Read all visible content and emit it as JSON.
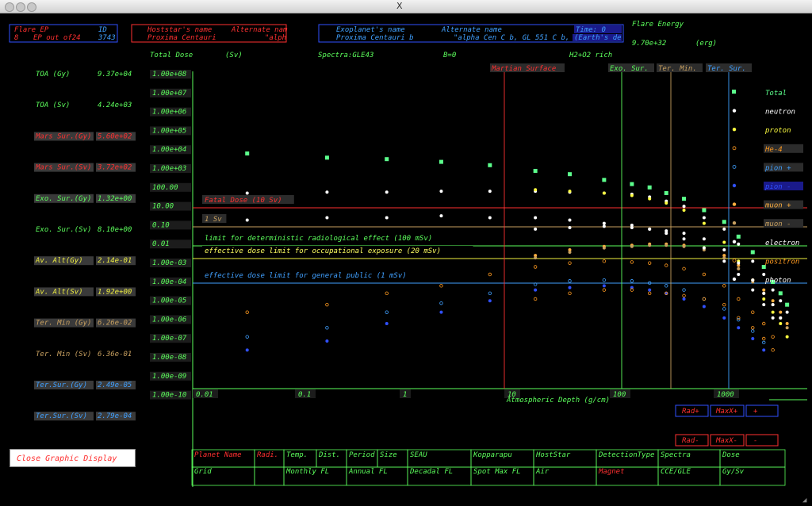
{
  "window": {
    "title_glyph": "X"
  },
  "header": {
    "flare_ep_label": "Flare EP",
    "id_label": "ID",
    "ep_index": "8",
    "ep_count_label": "EP out of24",
    "id_value": "3743",
    "hoststar_label": "Hoststar's name",
    "hoststar_alt_label": "Alternate nam",
    "hoststar_name": "Proxima Centauri",
    "hoststar_alt": "\"alph",
    "exoplanet_label": "Exoplanet's name",
    "exoplanet_alt_label": "Alternate name",
    "exoplanet_name": "Proxima Centauri b",
    "exoplanet_alt": "\"alpha Cen C b, GL 551 C b,",
    "time_label": "Time: 0",
    "earth_label": "(Earth's de",
    "flare_energy_label": "Flare Energy",
    "flare_energy_value": "9.70e+32",
    "flare_energy_unit": "(erg)"
  },
  "subheader": {
    "total_dose": "Total Dose",
    "unit": "(Sv)",
    "spectra": "Spectra:GLE43",
    "b_field": "B=0",
    "atmosphere": "H2+O2 rich"
  },
  "readouts": [
    {
      "label": "TOA (Gy)",
      "value": "9.37e+04",
      "color": "#5cff5c",
      "bg": "transparent"
    },
    {
      "label": "TOA (Sv)",
      "value": "4.24e+03",
      "color": "#5cff5c",
      "bg": "transparent"
    },
    {
      "label": "Mars Sur.(Gy)",
      "value": "5.60e+02",
      "color": "#ff3030",
      "bg": "#3a3a3a"
    },
    {
      "label": "Mars Sur.(Sv)",
      "value": "3.72e+02",
      "color": "#ff3030",
      "bg": "#3a3a3a"
    },
    {
      "label": "Exo. Sur.(Gy)",
      "value": "1.32e+00",
      "color": "#5cff5c",
      "bg": "#3a3a3a"
    },
    {
      "label": "Exo. Sur.(Sv)",
      "value": "8.10e+00",
      "color": "#5cff5c",
      "bg": "transparent"
    },
    {
      "label": "Av. Alt(Gy)",
      "value": "2.14e-01",
      "color": "#f0f040",
      "bg": "#3a3a3a"
    },
    {
      "label": "Av. Alt(Sv)",
      "value": "1.92e+00",
      "color": "#f0f040",
      "bg": "#3a3a3a"
    },
    {
      "label": "Ter. Min (Gy)",
      "value": "6.26e-02",
      "color": "#c8a060",
      "bg": "#3a3a3a"
    },
    {
      "label": "Ter. Min (Sv)",
      "value": "6.36e-01",
      "color": "#c8a060",
      "bg": "transparent"
    },
    {
      "label": "Ter.Sur.(Gy)",
      "value": "2.49e-05",
      "color": "#40a0ff",
      "bg": "#3a3a3a"
    },
    {
      "label": "Ter.Sur.(Sv)",
      "value": "2.79e-04",
      "color": "#40a0ff",
      "bg": "#3a3a3a"
    }
  ],
  "close_button": "Close Graphic Display",
  "chart_data": {
    "type": "scatter",
    "xlabel": "Atmospheric Depth (g/cm)",
    "ylabel": "",
    "x_scale": "log",
    "y_scale": "log",
    "xlim": [
      0.01,
      1800
    ],
    "ylim": [
      1e-10,
      100000000.0
    ],
    "x_tick_labels": [
      {
        "v": 0.01,
        "t": "0.01"
      },
      {
        "v": 0.1,
        "t": "0.1"
      },
      {
        "v": 1,
        "t": "1"
      },
      {
        "v": 10,
        "t": "10"
      },
      {
        "v": 100,
        "t": "100"
      },
      {
        "v": 1000,
        "t": "1000"
      }
    ],
    "y_tick_labels": [
      "1.00e+08",
      "1.00e+07",
      "1.00e+06",
      "1.00e+05",
      "1.00e+04",
      "1.00e+03",
      "100.00",
      "10.00",
      "0.10",
      "0.01",
      "1.00e-03",
      "1.00e-04",
      "1.00e-05",
      "1.00e-06",
      "1.00e-07",
      "1.00e-08",
      "1.00e-09",
      "1.00e-10"
    ],
    "grid": false,
    "legend_position": "right",
    "vertical_markers": [
      {
        "name": "Martian Surface",
        "x": 11,
        "color": "#ff3030"
      },
      {
        "name": "Exo. Sur.",
        "x": 110,
        "color": "#5cff5c"
      },
      {
        "name": "Ter. Min.",
        "x": 370,
        "color": "#c8a060"
      },
      {
        "name": "Ter. Sur.",
        "x": 1030,
        "color": "#40a0ff"
      }
    ],
    "horizontal_markers": [
      {
        "name": "Fatal Dose (10 Sv)",
        "y": 10,
        "color": "#ff3030"
      },
      {
        "name": "1 Sv",
        "y": 1,
        "color": "#c8a060"
      },
      {
        "name": "limit for deterministic radiological effect (100 mSv)",
        "y": 0.1,
        "color": "#5cff5c"
      },
      {
        "name": "effective dose limit for occupational exposure (20 mSv)",
        "y": 0.02,
        "color": "#f0f040"
      },
      {
        "name": "effective dose limit for general public (1 mSv)",
        "y": 0.001,
        "color": "#40a0ff"
      }
    ],
    "x": [
      0.03,
      0.15,
      0.5,
      1.5,
      4,
      10,
      20,
      40,
      70,
      100,
      140,
      200,
      300,
      450,
      600,
      800,
      1000,
      1200,
      1400,
      1600
    ],
    "series": [
      {
        "name": "Total",
        "color": "#5cff8c",
        "marker": "square",
        "values": [
          5000,
          3000,
          2500,
          1800,
          1200,
          600,
          400,
          200,
          120,
          80,
          40,
          20,
          5,
          1.2,
          0.2,
          0.03,
          0.005,
          0.0008,
          0.0002,
          5e-05
        ]
      },
      {
        "name": "neutron",
        "color": "#ffffff",
        "marker": "dot",
        "values": [
          40,
          45,
          45,
          50,
          50,
          50,
          45,
          40,
          35,
          25,
          15,
          8,
          2,
          0.5,
          0.08,
          0.01,
          0.002,
          0.0003,
          8e-05,
          2e-05
        ]
      },
      {
        "name": "proton",
        "color": "#ffff40",
        "marker": "dot",
        "values": [
          null,
          null,
          null,
          null,
          null,
          60,
          50,
          40,
          30,
          20,
          12,
          5,
          1,
          0.1,
          0.01,
          0.001,
          0.0001,
          2e-05,
          5e-06,
          1e-06
        ]
      },
      {
        "name": "He-4",
        "color": "#ff9a20",
        "marker": "ring",
        "values": [
          2e-05,
          5e-05,
          0.0002,
          0.0005,
          0.002,
          0.005,
          0.008,
          0.01,
          0.009,
          0.008,
          0.006,
          0.004,
          0.002,
          0.0005,
          0.0001,
          2e-05,
          5e-06,
          1e-06,
          null,
          null
        ]
      },
      {
        "name": "pion +",
        "color": "#40a0ff",
        "marker": "ring",
        "values": [
          1e-06,
          3e-06,
          2e-05,
          6e-05,
          0.0002,
          0.0006,
          0.0009,
          0.001,
          0.0009,
          0.0007,
          0.0005,
          0.0003,
          0.0001,
          3e-05,
          8e-06,
          2e-06,
          5e-07,
          null,
          null,
          null
        ]
      },
      {
        "name": "pion -",
        "color": "#3050ff",
        "marker": "dot",
        "values": [
          2e-07,
          6e-07,
          5e-06,
          2e-05,
          8e-05,
          0.0003,
          0.0004,
          0.0005,
          0.0004,
          0.0003,
          0.0002,
          0.0001,
          4e-05,
          1e-05,
          3e-06,
          8e-07,
          2e-07,
          null,
          null,
          null
        ]
      },
      {
        "name": "muon +",
        "color": "#ffb040",
        "marker": "dot",
        "values": [
          null,
          null,
          null,
          null,
          null,
          0.02,
          0.04,
          0.06,
          0.07,
          0.08,
          0.08,
          0.07,
          0.05,
          0.02,
          0.006,
          0.001,
          0.0003,
          8e-05,
          2e-05,
          5e-06
        ]
      },
      {
        "name": "muon -",
        "color": "#c8a060",
        "marker": "dot",
        "values": [
          null,
          null,
          null,
          null,
          null,
          0.015,
          0.03,
          0.05,
          0.06,
          0.07,
          0.07,
          0.06,
          0.04,
          0.015,
          0.004,
          0.0008,
          0.0002,
          5e-05,
          1e-05,
          3e-06
        ]
      },
      {
        "name": "electron",
        "color": "#ffffff",
        "marker": "dot",
        "values": [
          1.5,
          2,
          2,
          2.5,
          2,
          2,
          1.5,
          1,
          0.8,
          0.5,
          0.3,
          0.15,
          0.05,
          0.01,
          0.002,
          0.0003,
          5e-05,
          1e-05,
          null,
          null
        ]
      },
      {
        "name": "positron",
        "color": "#ff9a20",
        "marker": "ring",
        "values": [
          null,
          null,
          null,
          null,
          null,
          0.0001,
          0.0002,
          0.0003,
          0.0003,
          0.0002,
          0.0002,
          0.00015,
          0.0001,
          5e-05,
          1e-05,
          3e-06,
          8e-07,
          2e-07,
          null,
          null
        ]
      },
      {
        "name": "photon",
        "color": "#ffffff",
        "marker": "dot",
        "values": [
          null,
          null,
          null,
          null,
          null,
          0.5,
          0.6,
          0.7,
          0.6,
          0.5,
          0.4,
          0.3,
          0.15,
          0.04,
          0.008,
          0.001,
          0.0002,
          5e-05,
          1e-05,
          null
        ]
      }
    ]
  },
  "bottom_buttons": {
    "row1": [
      "Planet Name",
      "Radi.",
      "Temp.",
      "Dist.",
      "Period",
      "Size",
      "SEAU",
      "Kopparapu",
      "HostStar",
      "DetectionType",
      "Spectra",
      "Dose"
    ],
    "row1_colors": [
      "#ff3030",
      "#ff3030",
      "#5cff5c",
      "#5cff5c",
      "#5cff5c",
      "#5cff5c",
      "#5cff5c",
      "#5cff5c",
      "#5cff5c",
      "#5cff5c",
      "#5cff5c",
      "#5cff5c"
    ],
    "row2": [
      "Grid",
      "",
      "Monthly FL",
      "Annual FL",
      "Decadal FL",
      "Spot Max FL",
      "Air",
      "Magnet",
      "CCE/GLE",
      "Gy/Sv"
    ],
    "row2_colors": [
      "#5cff5c",
      "#5cff5c",
      "#5cff5c",
      "#5cff5c",
      "#5cff5c",
      "#5cff5c",
      "#5cff5c",
      "#ff3030",
      "#5cff5c",
      "#5cff5c"
    ]
  },
  "range_buttons": {
    "rad_plus": "Rad+",
    "maxx_plus": "MaxX+",
    "plus": "+",
    "rad_minus": "Rad-",
    "maxx_minus": "MaxX-",
    "minus": "-"
  }
}
